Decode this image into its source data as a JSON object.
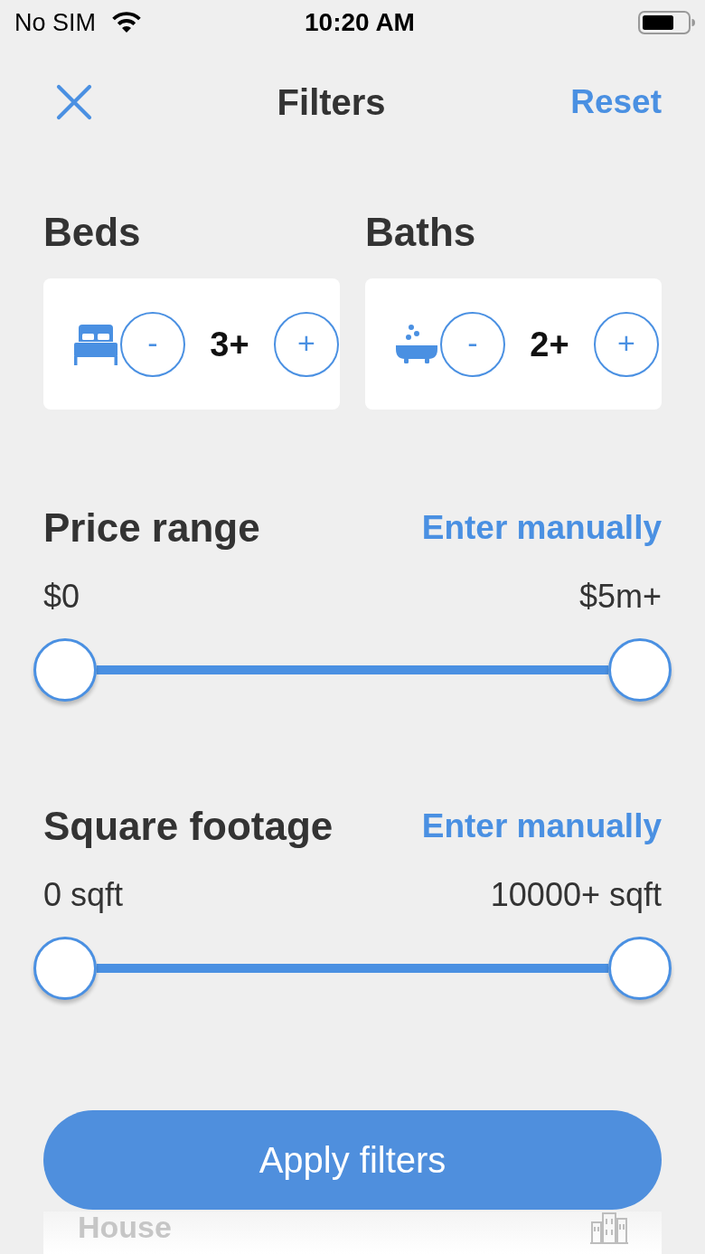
{
  "status_bar": {
    "carrier": "No SIM",
    "time": "10:20 AM"
  },
  "header": {
    "title": "Filters",
    "reset_button": "Reset"
  },
  "counters": [
    {
      "kind": "bed",
      "label": "Beds",
      "minus_button": "-",
      "value": "3+",
      "plus_button": "+"
    },
    {
      "kind": "bath",
      "label": "Baths",
      "minus_button": "-",
      "value": "2+",
      "plus_button": "+"
    }
  ],
  "ranges": [
    {
      "title": "Price range",
      "action": "Enter manually",
      "min_label": "$0",
      "max_label": "$5m+",
      "thumbs": [
        {
          "level": 0
        },
        {
          "level": 1
        }
      ]
    },
    {
      "title": "Square footage",
      "action": "Enter manually",
      "min_label": "0 sqft",
      "max_label": "10000+ sqft",
      "thumbs": [
        {
          "level": 0
        },
        {
          "level": 1
        }
      ]
    }
  ],
  "options": [
    {
      "label": "House"
    }
  ],
  "apply_button": "Apply filters"
}
